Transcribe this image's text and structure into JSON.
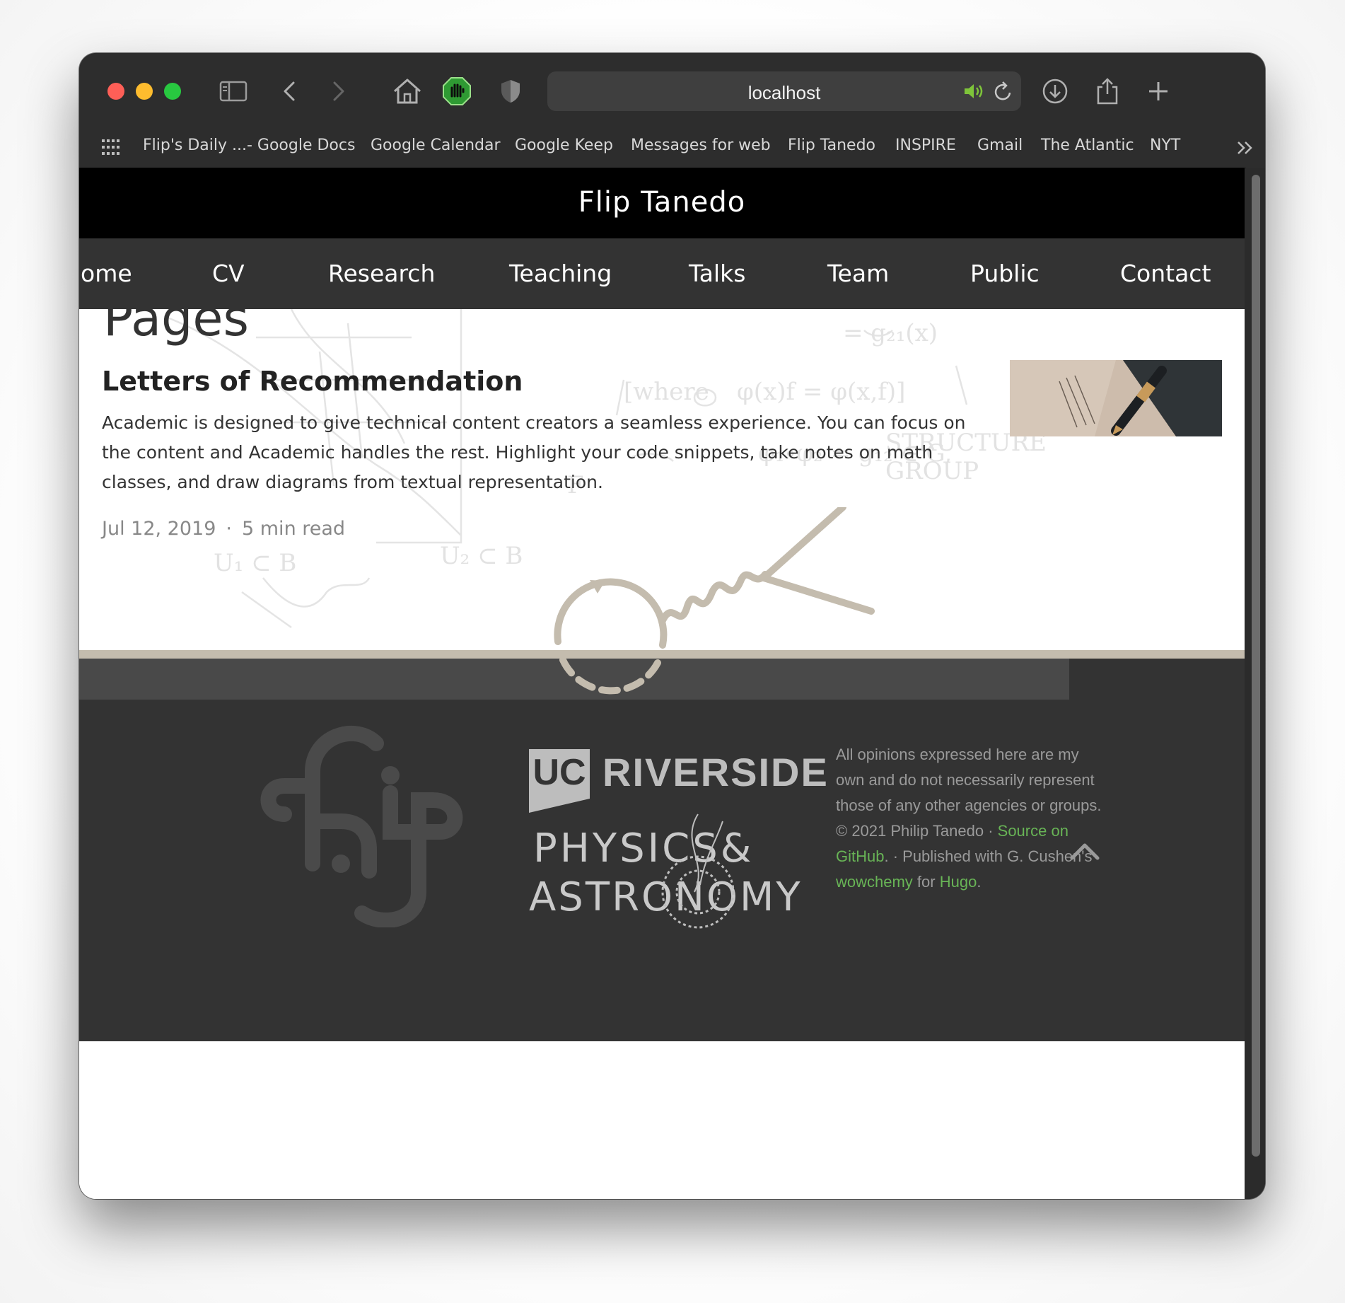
{
  "browser": {
    "url": "localhost",
    "bookmarks": [
      "Flip's Daily ...- Google Docs",
      "Google Calendar",
      "Google Keep",
      "Messages for web",
      "Flip Tanedo",
      "INSPIRE",
      "Gmail",
      "The Atlantic",
      "NYT"
    ]
  },
  "site": {
    "title": "Flip Tanedo",
    "nav": [
      "ome",
      "CV",
      "Research",
      "Teaching",
      "Talks",
      "Team",
      "Public",
      "Contact"
    ]
  },
  "main": {
    "heading": "Pages",
    "post": {
      "title": "Letters of Recommendation",
      "summary": "Academic is designed to give technical content creators a seamless experience. You can focus on the content and Academic handles the rest. Highlight your code snippets, take notes on math classes, and draw diagrams from textual representation.",
      "date": "Jul 12, 2019",
      "separator": "·",
      "read_time": "5 min read"
    }
  },
  "footer": {
    "ucr_box": "UC",
    "ucr_word": "RIVERSIDE",
    "dept_line1": "PHYSICS&",
    "dept_line2": "ASTRONOMY",
    "disclaimer": "All opinions expressed here are my own and do not necessarily represent those of any other agencies or groups.",
    "copyright": "© 2021 Philip Tanedo · ",
    "source_link": "Source on GitHub",
    "published": ". · Published with G. Cushen's ",
    "wowchemy_link": "wowchemy",
    "for_text": " for ",
    "hugo_link": "Hugo",
    "period": "."
  },
  "colors": {
    "accent_link": "#68b456",
    "nav_bg": "#333333",
    "header_bg": "#000000",
    "feynman_tan": "#c4bcae"
  }
}
